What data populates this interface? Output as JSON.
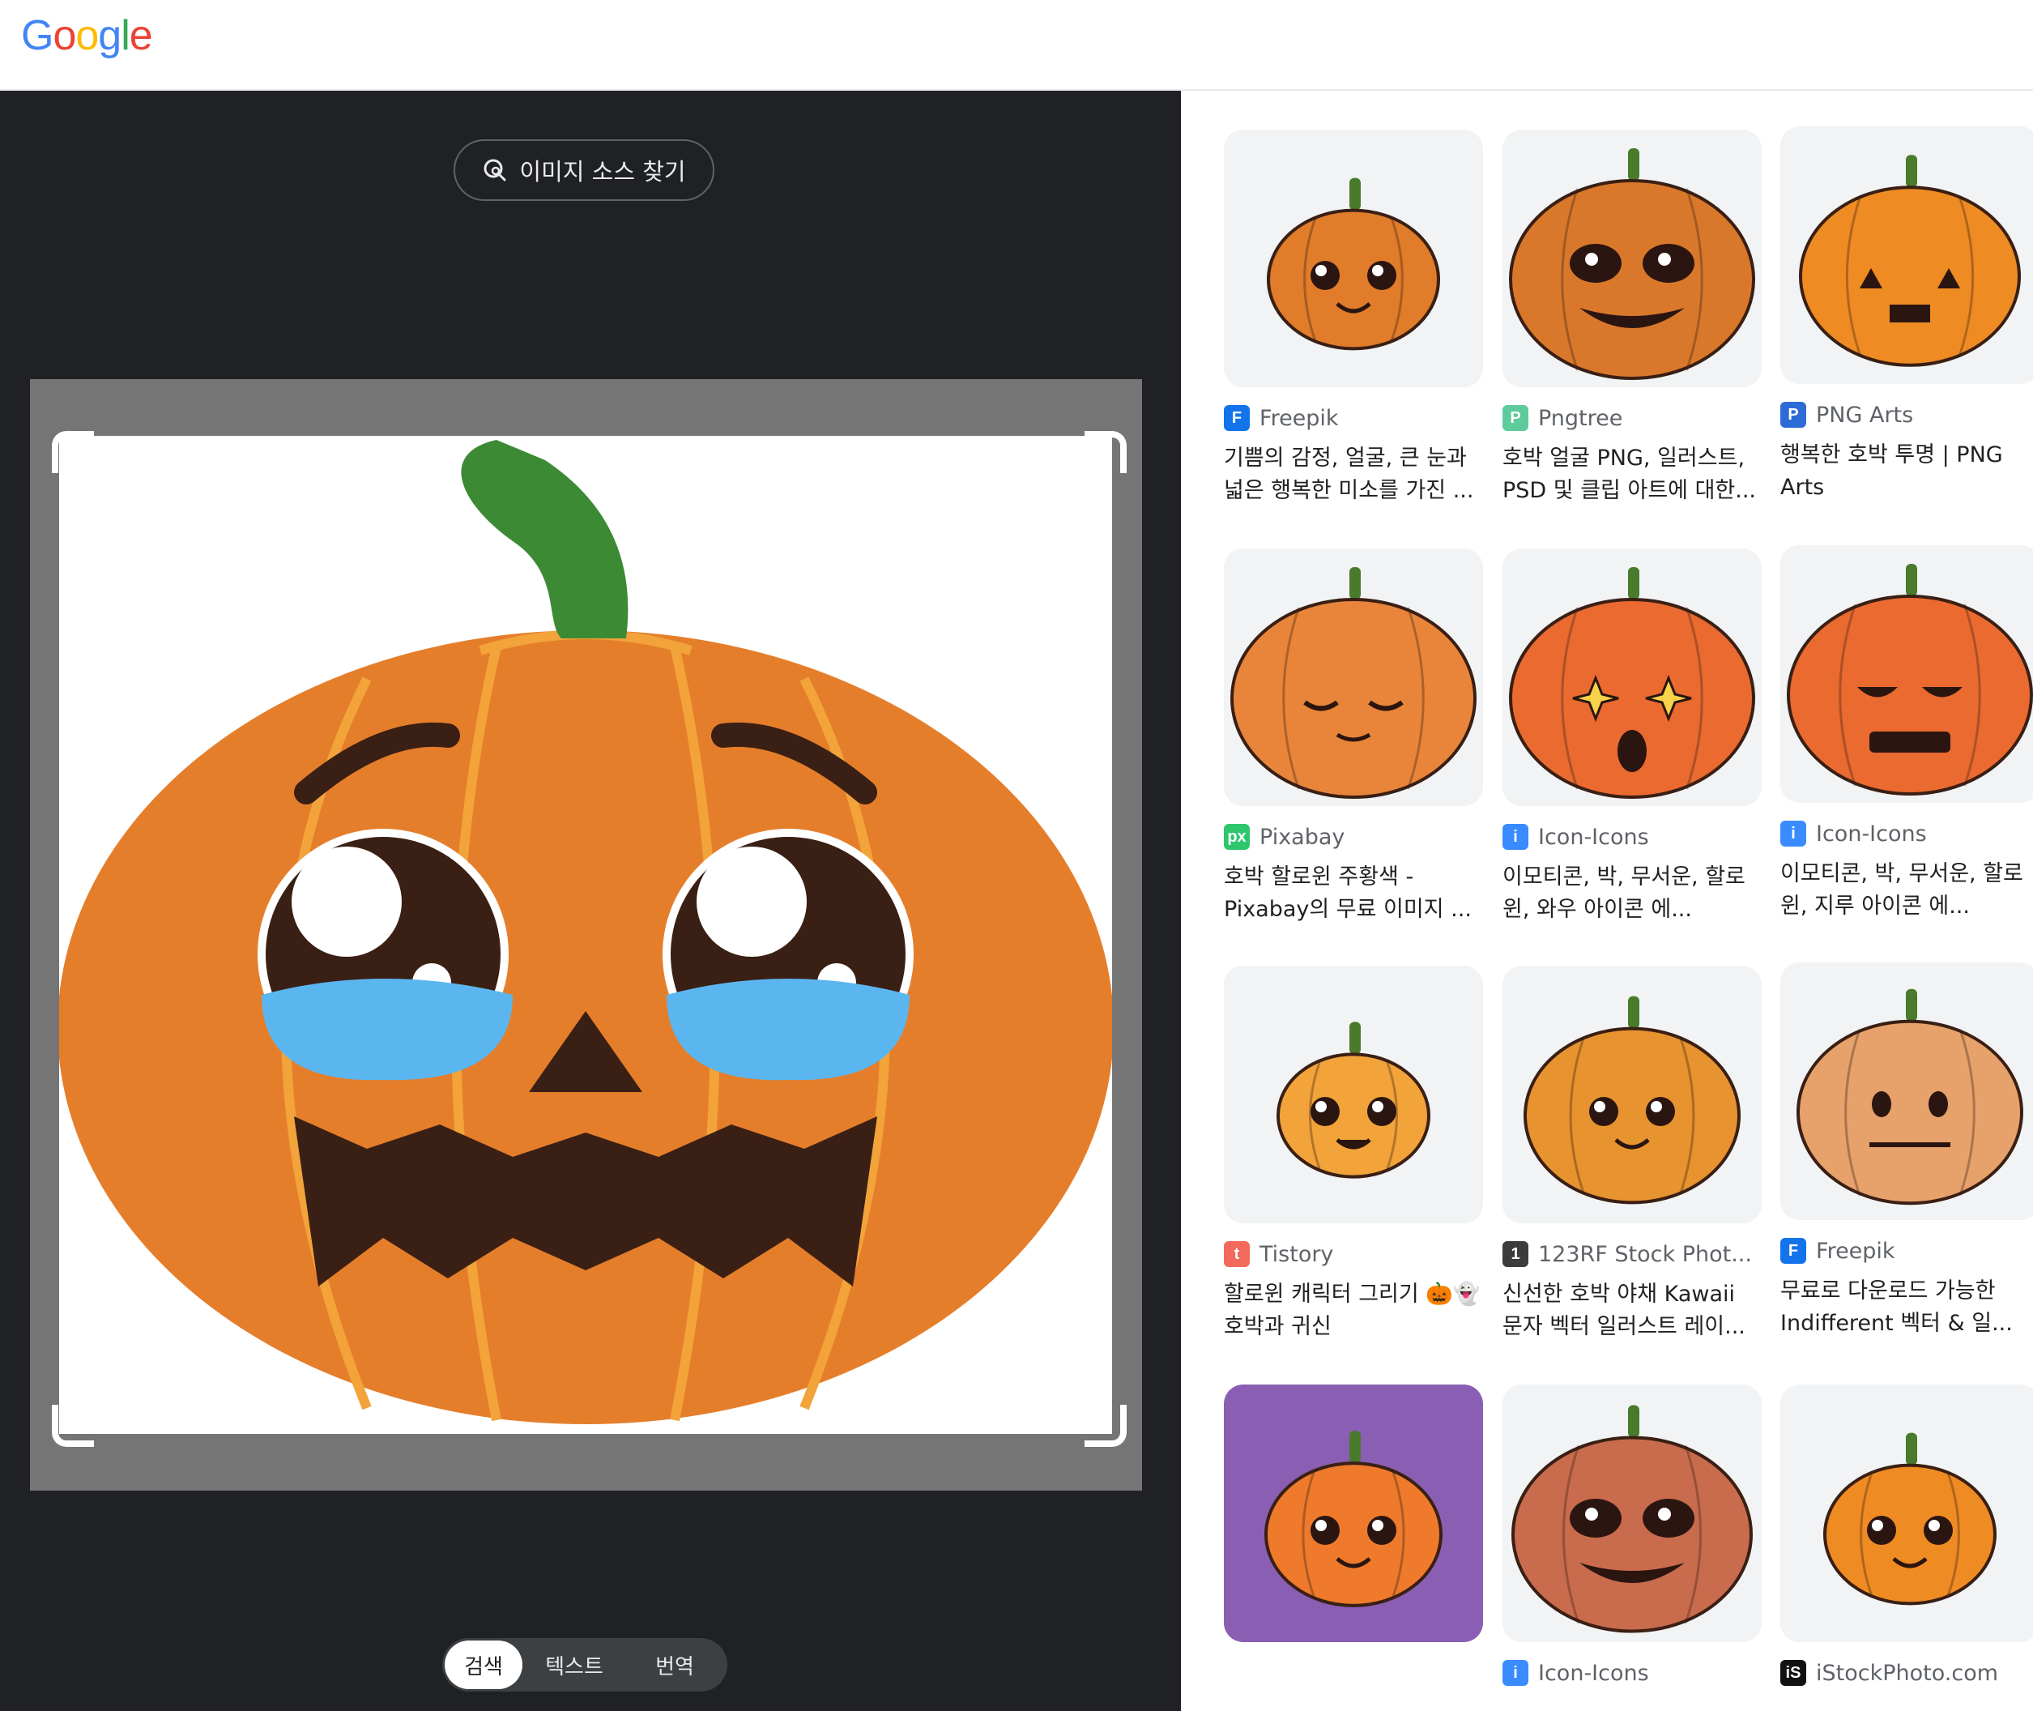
{
  "header": {
    "logo_letters": [
      "G",
      "o",
      "o",
      "g",
      "l",
      "e"
    ],
    "logo_colors": [
      "#4285F4",
      "#EA4335",
      "#FBBC05",
      "#4285F4",
      "#34A853",
      "#EA4335"
    ]
  },
  "viewer": {
    "find_source_label": "이미지 소스 찾기",
    "tabs": [
      "검색",
      "텍스트",
      "번역"
    ],
    "active_tab": "검색"
  },
  "results": [
    {
      "source": "Freepik",
      "favicon": "F",
      "favicon_color": "#1273eb",
      "title": [
        "기쁨의 감정, 얼굴, 큰 눈과",
        "넓은 행복한 미소를 가진 ..."
      ]
    },
    {
      "source": "Pngtree",
      "favicon": "P",
      "favicon_color": "#5ecb9b",
      "title": [
        "호박 얼굴 PNG, 일러스트,",
        "PSD 및 클립 아트에 대한..."
      ]
    },
    {
      "source": "PNG Arts",
      "favicon": "P",
      "favicon_color": "#2d6bd6",
      "title": [
        "행복한 호박 투명 | PNG",
        "Arts"
      ]
    },
    {
      "source": "Pixabay",
      "favicon": "px",
      "favicon_color": "#2ec66d",
      "title": [
        "호박 할로윈 주황색 -",
        "Pixabay의 무료 이미지 ..."
      ]
    },
    {
      "source": "Icon-Icons",
      "favicon": "i",
      "favicon_color": "#3a8bff",
      "title": [
        "이모티콘, 박, 무서운, 할로",
        "윈, 와우 아이콘 에..."
      ]
    },
    {
      "source": "Icon-Icons",
      "favicon": "i",
      "favicon_color": "#3a8bff",
      "title": [
        "이모티콘, 박, 무서운, 할로",
        "윈, 지루 아이콘 에..."
      ]
    },
    {
      "source": "Tistory",
      "favicon": "t",
      "favicon_color": "#f26a5c",
      "title": [
        "할로윈 캐릭터 그리기 🎃👻",
        "호박과 귀신"
      ]
    },
    {
      "source": "123RF Stock Phot...",
      "favicon": "1",
      "favicon_color": "#3c3c3c",
      "title": [
        "신선한 호박 야채 Kawaii",
        "문자 벡터 일러스트 레이..."
      ]
    },
    {
      "source": "Freepik",
      "favicon": "F",
      "favicon_color": "#1273eb",
      "title": [
        "무료로 다운로드 가능한",
        "Indifferent 벡터 & 일..."
      ]
    },
    {
      "source": "",
      "favicon": "",
      "favicon_color": "",
      "title": []
    },
    {
      "source": "Icon-Icons",
      "favicon": "i",
      "favicon_color": "#3a8bff",
      "title": []
    },
    {
      "source": "iStockPhoto.com",
      "favicon": "iS",
      "favicon_color": "#111111",
      "title": []
    }
  ]
}
